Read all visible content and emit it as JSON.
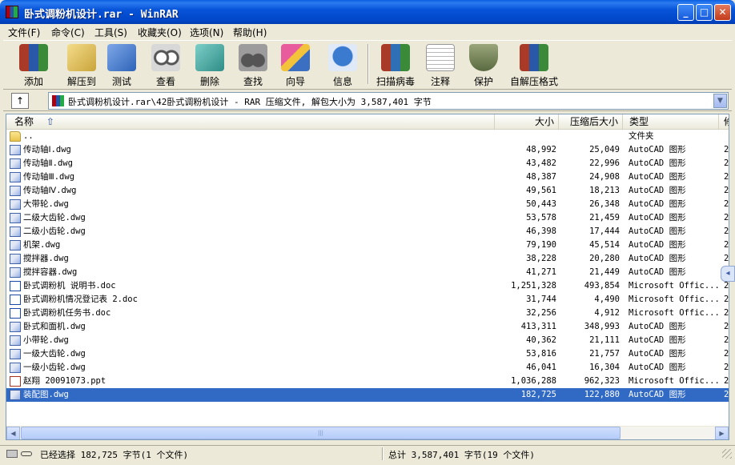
{
  "window": {
    "title": "卧式调粉机设计.rar - WinRAR",
    "controls": {
      "minimize": "_",
      "maximize": "□",
      "close": "✕"
    }
  },
  "menu": [
    {
      "label": "文件(F)"
    },
    {
      "label": "命令(C)"
    },
    {
      "label": "工具(S)"
    },
    {
      "label": "收藏夹(O)"
    },
    {
      "label": "选项(N)"
    },
    {
      "label": "帮助(H)"
    }
  ],
  "toolbar": [
    {
      "label": "添加",
      "icon": "add-archive-icon",
      "color": "#a93a27"
    },
    {
      "label": "解压到",
      "icon": "extract-to-icon",
      "color": "#c9a43a"
    },
    {
      "label": "测试",
      "icon": "test-icon",
      "color": "#2d63b8"
    },
    {
      "label": "查看",
      "icon": "view-icon",
      "color": "#8a8a8a"
    },
    {
      "label": "删除",
      "icon": "delete-icon",
      "color": "#2f8c86"
    },
    {
      "label": "查找",
      "icon": "find-icon",
      "color": "#3b3b3b"
    },
    {
      "label": "向导",
      "icon": "wizard-icon",
      "color": "#c23a7a"
    },
    {
      "label": "信息",
      "icon": "info-icon",
      "color": "#3a7bd0"
    },
    {
      "label": "扫描病毒",
      "icon": "virus-scan-icon",
      "color": "#2f6fb5"
    },
    {
      "label": "注释",
      "icon": "comment-icon",
      "color": "#e8e8e8"
    },
    {
      "label": "保护",
      "icon": "protect-icon",
      "color": "#5a6a40"
    },
    {
      "label": "自解压格式",
      "icon": "sfx-icon",
      "color": "#b48a2a"
    }
  ],
  "address": {
    "up_label": "↑",
    "path": "卧式调粉机设计.rar\\42卧式调粉机设计 - RAR 压缩文件, 解包大小为 3,587,401 字节",
    "dropdown": "▼"
  },
  "columns": {
    "name": "名称",
    "sort_indicator": "⇧",
    "size": "大小",
    "packed": "压缩后大小",
    "type": "类型",
    "more": "修"
  },
  "files": [
    {
      "name": "..",
      "size": "",
      "packed": "",
      "type": "文件夹",
      "more": "",
      "icon": "folder-icon",
      "selected": false
    },
    {
      "name": "传动轴Ⅰ.dwg",
      "size": "48,992",
      "packed": "25,049",
      "type": "AutoCAD 图形",
      "more": "2",
      "icon": "dwg-icon",
      "selected": false
    },
    {
      "name": "传动轴Ⅱ.dwg",
      "size": "43,482",
      "packed": "22,996",
      "type": "AutoCAD 图形",
      "more": "2",
      "icon": "dwg-icon",
      "selected": false
    },
    {
      "name": "传动轴Ⅲ.dwg",
      "size": "48,387",
      "packed": "24,908",
      "type": "AutoCAD 图形",
      "more": "2",
      "icon": "dwg-icon",
      "selected": false
    },
    {
      "name": "传动轴Ⅳ.dwg",
      "size": "49,561",
      "packed": "18,213",
      "type": "AutoCAD 图形",
      "more": "2",
      "icon": "dwg-icon",
      "selected": false
    },
    {
      "name": "大带轮.dwg",
      "size": "50,443",
      "packed": "26,348",
      "type": "AutoCAD 图形",
      "more": "2",
      "icon": "dwg-icon",
      "selected": false
    },
    {
      "name": "二级大齿轮.dwg",
      "size": "53,578",
      "packed": "21,459",
      "type": "AutoCAD 图形",
      "more": "2",
      "icon": "dwg-icon",
      "selected": false
    },
    {
      "name": "二级小齿轮.dwg",
      "size": "46,398",
      "packed": "17,444",
      "type": "AutoCAD 图形",
      "more": "2",
      "icon": "dwg-icon",
      "selected": false
    },
    {
      "name": "机架.dwg",
      "size": "79,190",
      "packed": "45,514",
      "type": "AutoCAD 图形",
      "more": "2",
      "icon": "dwg-icon",
      "selected": false
    },
    {
      "name": "搅拌器.dwg",
      "size": "38,228",
      "packed": "20,280",
      "type": "AutoCAD 图形",
      "more": "2",
      "icon": "dwg-icon",
      "selected": false
    },
    {
      "name": "搅拌容器.dwg",
      "size": "41,271",
      "packed": "21,449",
      "type": "AutoCAD 图形",
      "more": "2",
      "icon": "dwg-icon",
      "selected": false
    },
    {
      "name": "卧式调粉机 说明书.doc",
      "size": "1,251,328",
      "packed": "493,854",
      "type": "Microsoft Offic...",
      "more": "2",
      "icon": "doc-icon",
      "selected": false
    },
    {
      "name": "卧式调粉机情况登记表 2.doc",
      "size": "31,744",
      "packed": "4,490",
      "type": "Microsoft Offic...",
      "more": "2",
      "icon": "doc-icon",
      "selected": false
    },
    {
      "name": "卧式调粉机任务书.doc",
      "size": "32,256",
      "packed": "4,912",
      "type": "Microsoft Offic...",
      "more": "2",
      "icon": "doc-icon",
      "selected": false
    },
    {
      "name": "卧式和面机.dwg",
      "size": "413,311",
      "packed": "348,993",
      "type": "AutoCAD 图形",
      "more": "2",
      "icon": "dwg-icon",
      "selected": false
    },
    {
      "name": "小带轮.dwg",
      "size": "40,362",
      "packed": "21,111",
      "type": "AutoCAD 图形",
      "more": "2",
      "icon": "dwg-icon",
      "selected": false
    },
    {
      "name": "一级大齿轮.dwg",
      "size": "53,816",
      "packed": "21,757",
      "type": "AutoCAD 图形",
      "more": "2",
      "icon": "dwg-icon",
      "selected": false
    },
    {
      "name": "一级小齿轮.dwg",
      "size": "46,041",
      "packed": "16,304",
      "type": "AutoCAD 图形",
      "more": "2",
      "icon": "dwg-icon",
      "selected": false
    },
    {
      "name": "赵翔 20091073.ppt",
      "size": "1,036,288",
      "packed": "962,323",
      "type": "Microsoft Offic...",
      "more": "2",
      "icon": "ppt-icon",
      "selected": false
    },
    {
      "name": "装配图.dwg",
      "size": "182,725",
      "packed": "122,880",
      "type": "AutoCAD 图形",
      "more": "2",
      "icon": "dwg-icon",
      "selected": true
    }
  ],
  "scrollbar": {
    "left": "◀",
    "right": "▶",
    "grip": "|||"
  },
  "status": {
    "left": "已经选择 182,725 字节(1 个文件)",
    "right": "总计 3,587,401 字节(19 个文件)"
  },
  "side_tab": "◂"
}
